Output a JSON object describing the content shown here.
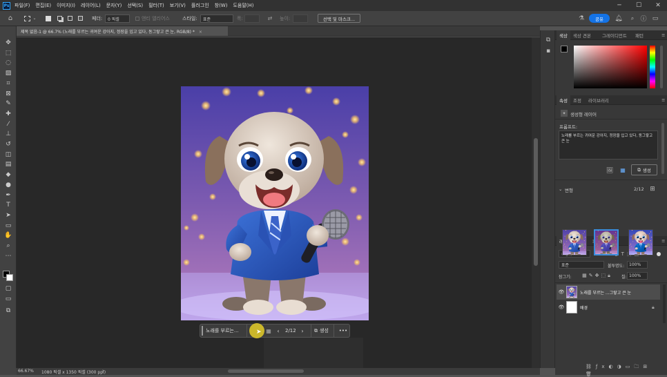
{
  "app": {
    "logo": "Ps",
    "name": "Photoshop"
  },
  "menu": [
    "파일(F)",
    "편집(E)",
    "이미지(I)",
    "레이어(L)",
    "문자(Y)",
    "선택(S)",
    "필터(T)",
    "보기(V)",
    "플러그인",
    "창(W)",
    "도움말(H)"
  ],
  "window_buttons": {
    "minimize": "─",
    "maximize": "☐",
    "close": "✕"
  },
  "options": {
    "feather_label": "페더:",
    "feather_value": "0 픽셀",
    "antialias_label": "앤티 앨리어스",
    "style_label": "스타일:",
    "style_value": "표준",
    "width_label": "폭:",
    "height_label": "높이:",
    "select_mask_button": "선택 및 마스크...",
    "share_button": "공유"
  },
  "document": {
    "tab_title": "제목 없음-1 @ 66.7% (노래를 부르는 귀여운 강아지, 정장을 입고 있다, 동그랗고 큰 눈, RGB/8) *",
    "zoom": "66.67%",
    "info": "1080 픽셀 x 1350 픽셀 (300 ppi)"
  },
  "contextual_bar": {
    "prompt_text": "노래를 부르는...",
    "counter": "2/12",
    "generate_label": "생성",
    "more": "•••"
  },
  "color_panel": {
    "tabs": [
      "색상",
      "색상 견본",
      "그레이디언트",
      "패턴"
    ],
    "active": 0
  },
  "properties_panel": {
    "tabs": [
      "속성",
      "조정",
      "라이브러리"
    ],
    "active": 0,
    "type_label": "생성형 레이어",
    "prompt_label": "프롬프트:",
    "prompt_value": "노래를 부르는 귀여운 강아지, 정장을 입고 있다, 동그랗고 큰 눈",
    "generate_label": "생성",
    "variations_label": "변형",
    "variations_count": "2/12"
  },
  "layers_panel": {
    "tabs": [
      "레이어",
      "채널",
      "패스"
    ],
    "active": 0,
    "kind_filter": "종류",
    "blend_mode": "표준",
    "opacity_label": "불투명도:",
    "opacity_value": "100%",
    "lock_label": "잠그기:",
    "fill_label": "칠:",
    "fill_value": "100%",
    "layers": [
      {
        "name": "노래를 부르는 ...그랗고 큰 눈",
        "selected": true
      },
      {
        "name": "배경",
        "selected": false
      }
    ]
  },
  "colors": {
    "accent": "#1473e6",
    "selection": "#3a8dde"
  }
}
